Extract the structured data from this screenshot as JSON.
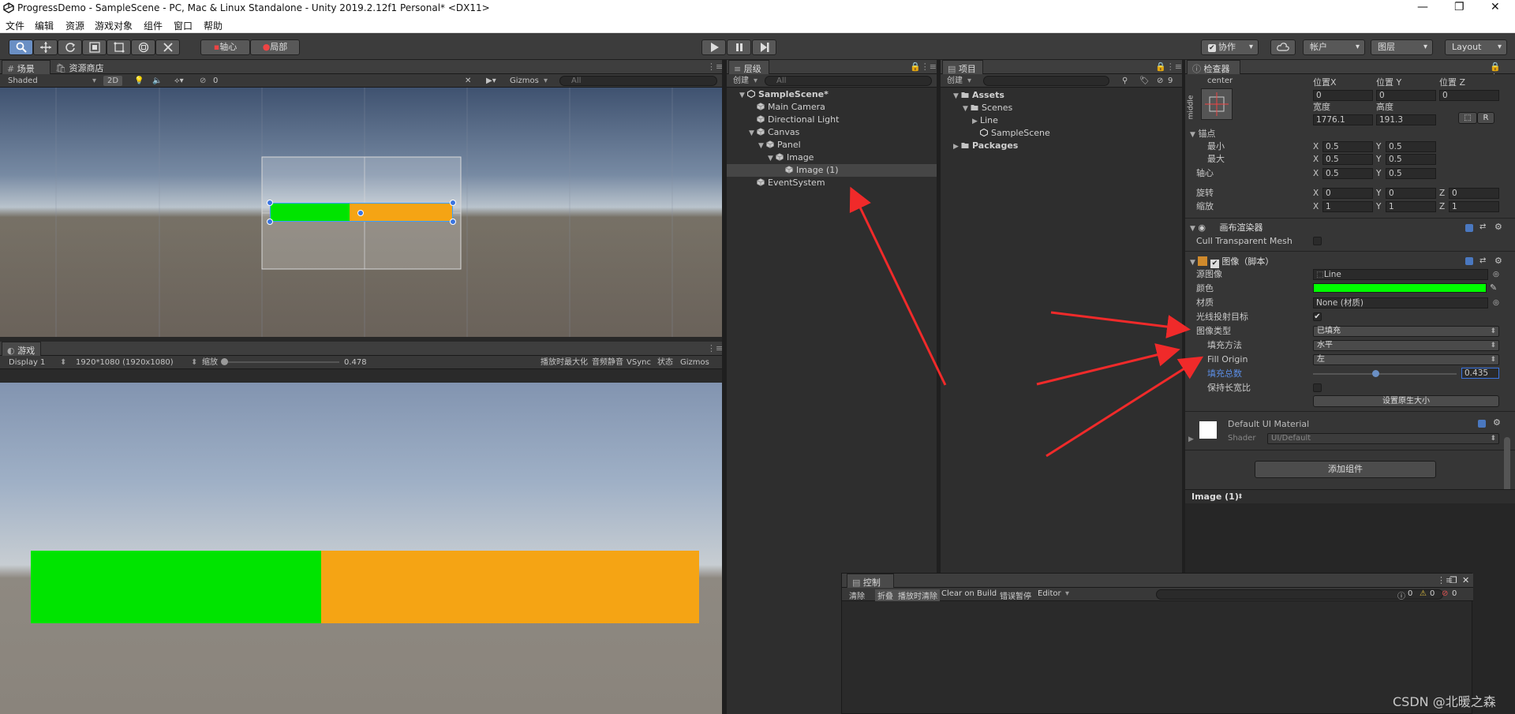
{
  "window": {
    "title": "ProgressDemo - SampleScene - PC, Mac & Linux Standalone - Unity 2019.2.12f1 Personal* <DX11>",
    "controls": [
      "—",
      "❐",
      "✕"
    ]
  },
  "menu": [
    "文件",
    "编辑",
    "资源",
    "游戏对象",
    "组件",
    "窗口",
    "帮助"
  ],
  "toolbar": {
    "pivot": "轴心",
    "local": "局部",
    "collab": "协作",
    "account": "帐户",
    "layers": "图层",
    "layout": "Layout"
  },
  "scene": {
    "tab": "场景",
    "asset_store_tab": "资源商店",
    "shading": "Shaded",
    "mode2d": "2D",
    "hidden_count": "0",
    "gizmos": "Gizmos",
    "search_placeholder": "All"
  },
  "game": {
    "tab": "游戏",
    "display": "Display 1",
    "resolution": "1920*1080 (1920x1080)",
    "scale_label": "缩放",
    "scale_value": "0.478",
    "scale_fraction": 0.478,
    "maximize": "播放时最大化",
    "mute": "音频静音",
    "vsync": "VSync",
    "stats": "状态",
    "gizmos": "Gizmos",
    "fill_amount": 0.435,
    "fill_color": "#00e400",
    "bg_color": "#f5a414"
  },
  "hierarchy": {
    "tab": "层级",
    "create": "创建",
    "search_placeholder": "All",
    "rows": [
      {
        "label": "SampleScene*",
        "depth": 0,
        "arrow": "▼",
        "type": "scene"
      },
      {
        "label": "Main Camera",
        "depth": 1,
        "arrow": "",
        "type": "go"
      },
      {
        "label": "Directional Light",
        "depth": 1,
        "arrow": "",
        "type": "go"
      },
      {
        "label": "Canvas",
        "depth": 1,
        "arrow": "▼",
        "type": "go"
      },
      {
        "label": "Panel",
        "depth": 2,
        "arrow": "▼",
        "type": "go"
      },
      {
        "label": "Image",
        "depth": 3,
        "arrow": "▼",
        "type": "go"
      },
      {
        "label": "Image (1)",
        "depth": 4,
        "arrow": "",
        "type": "go",
        "selected": true
      },
      {
        "label": "EventSystem",
        "depth": 1,
        "arrow": "",
        "type": "go"
      }
    ]
  },
  "project": {
    "tab": "项目",
    "create": "创建",
    "count": "9",
    "rows": [
      {
        "label": "Assets",
        "depth": 0,
        "arrow": "▼",
        "type": "folder",
        "bold": true
      },
      {
        "label": "Scenes",
        "depth": 1,
        "arrow": "▼",
        "type": "folder"
      },
      {
        "label": "Line",
        "depth": 2,
        "arrow": "▶",
        "type": "none"
      },
      {
        "label": "SampleScene",
        "depth": 2,
        "arrow": "",
        "type": "unity"
      },
      {
        "label": "Packages",
        "depth": 0,
        "arrow": "▶",
        "type": "folder",
        "bold": true
      }
    ]
  },
  "inspector": {
    "tab": "检查器",
    "anchor_h": "center",
    "anchor_v": "middle",
    "pos_x_label": "位置X",
    "pos_y_label": "位置 Y",
    "pos_z_label": "位置 Z",
    "pos_x": "0",
    "pos_y": "0",
    "pos_z": "0",
    "width_label": "宽度",
    "height_label": "高度",
    "width": "1776.1",
    "height": "191.3",
    "raw_btn": "R",
    "anchors_label": "锚点",
    "min_label": "最小",
    "max_label": "最大",
    "pivot_label": "轴心",
    "rotation_label": "旋转",
    "scale_label": "缩放",
    "x": "X",
    "y": "Y",
    "z": "Z",
    "anchor_min_x": "0.5",
    "anchor_min_y": "0.5",
    "anchor_max_x": "0.5",
    "anchor_max_y": "0.5",
    "pivot_x": "0.5",
    "pivot_y": "0.5",
    "rot_x": "0",
    "rot_y": "0",
    "rot_z": "0",
    "scale_x": "1",
    "scale_y": "1",
    "scale_z": "1",
    "canvas_renderer": "画布渲染器",
    "cull_label": "Cull Transparent Mesh",
    "image_component": "图像（脚本）",
    "source_image_label": "源图像",
    "source_image": "Line",
    "color_label": "颜色",
    "color_value": "#00ff00",
    "material_label": "材质",
    "material": "None (材质)",
    "raycast_label": "光线投射目标",
    "image_type_label": "图像类型",
    "image_type": "已填充",
    "fill_method_label": "填充方法",
    "fill_method": "水平",
    "fill_origin_label": "Fill Origin",
    "fill_origin": "左",
    "fill_amount_label": "填充总数",
    "fill_amount": "0.435",
    "fill_amount_fraction": 0.435,
    "preserve_label": "保持长宽比",
    "native_size": "设置原生大小",
    "material_name": "Default UI Material",
    "shader_label": "Shader",
    "shader": "UI/Default",
    "add_component": "添加组件",
    "footer": "Image (1)"
  },
  "console": {
    "tab": "控制台",
    "clear": "清除",
    "collapse": "折叠",
    "clear_on_play": "播放时清除",
    "clear_on_build": "Clear on Build",
    "error_pause": "错误暂停",
    "editor": "Editor",
    "log_count": "0",
    "warn_count": "0",
    "err_count": "0"
  },
  "watermark": "CSDN @北暖之森"
}
